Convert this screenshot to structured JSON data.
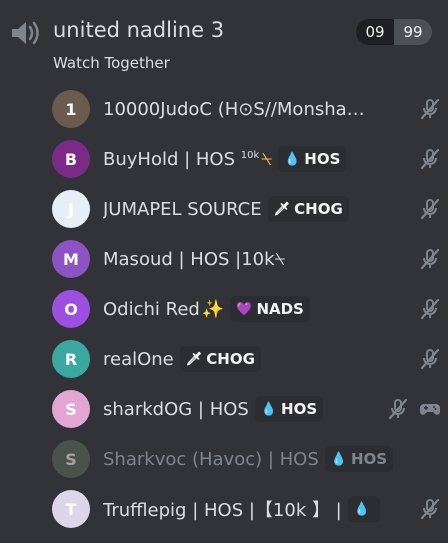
{
  "channel": {
    "name": "united nadline 3",
    "limit_current": "09",
    "limit_max": "99",
    "activity": "Watch Together"
  },
  "users": [
    {
      "name": "10000JudoC (H⊙S//Monsha…",
      "tag": "",
      "avatar_color": "#6b5a4e",
      "avatar_letter": "1",
      "status_icons": [
        "muted-mic-icon"
      ]
    },
    {
      "name": "BuyHold | HOS ",
      "name_sup": "10k",
      "name_suffix": "⍀",
      "tag": "HOS",
      "tag_icon": "💧",
      "avatar_color": "#7b2a86",
      "avatar_letter": "B",
      "status_icons": [
        "muted-mic-icon"
      ]
    },
    {
      "name": "JUMAPEL SOURCE",
      "tag": "CHOG",
      "tag_icon": "🗡",
      "avatar_color": "#e8eef7",
      "avatar_letter": "J",
      "status_icons": [
        "muted-mic-icon"
      ]
    },
    {
      "name": "Masoud | HOS |10k⍀",
      "tag": "",
      "avatar_color": "#8d52c4",
      "avatar_letter": "M",
      "status_icons": [
        "muted-mic-icon"
      ]
    },
    {
      "name": "Odichi Red",
      "name_suffix": "✨",
      "tag": "NADS",
      "tag_icon": "💜",
      "avatar_color": "#9d4fe0",
      "avatar_letter": "O",
      "status_icons": [
        "muted-mic-icon"
      ]
    },
    {
      "name": "realOne",
      "tag": "CHOG",
      "tag_icon": "🗡",
      "avatar_color": "#3aa8a0",
      "avatar_letter": "R",
      "status_icons": [
        "muted-mic-icon"
      ]
    },
    {
      "name": "sharkdOG | HOS",
      "tag": "HOS",
      "tag_icon": "💧",
      "avatar_color": "#e3a6d3",
      "avatar_letter": "S",
      "status_icons": [
        "muted-mic-icon",
        "gamepad-icon"
      ]
    },
    {
      "name": "Sharkvoc (Havoc) | HOS",
      "tag": "HOS",
      "tag_icon": "💧",
      "avatar_color": "#5d6e5a",
      "avatar_letter": "S",
      "dim": true,
      "status_icons": []
    },
    {
      "name": "Trufflepig | HOS |【10k 】 |",
      "tag": "",
      "tag_icon": "💧",
      "avatar_color": "#ddd5e8",
      "avatar_letter": "T",
      "status_icons": [
        "muted-mic-icon"
      ]
    }
  ],
  "colors": {
    "background": "#313338",
    "text": "#dbdee1",
    "muted": "#80848e"
  }
}
